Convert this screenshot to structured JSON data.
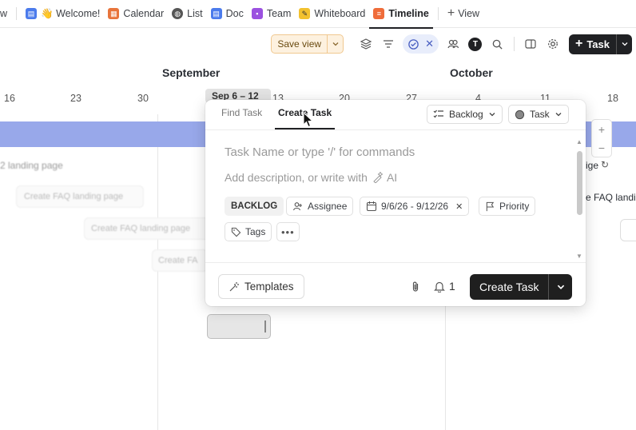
{
  "tabs": [
    {
      "label": "w",
      "icon": "",
      "color": ""
    },
    {
      "label": "👋 Welcome!",
      "icon": "doc-icon",
      "color": "#4b7bec"
    },
    {
      "label": "Calendar",
      "icon": "calendar-icon",
      "color": "#e8743b"
    },
    {
      "label": "List",
      "icon": "globe-icon",
      "color": "#555"
    },
    {
      "label": "Doc",
      "icon": "doc-icon",
      "color": "#4b7bec"
    },
    {
      "label": "Team",
      "icon": "team-icon",
      "color": "#9b51e0"
    },
    {
      "label": "Whiteboard",
      "icon": "whiteboard-icon",
      "color": "#f2c12e"
    },
    {
      "label": "Timeline",
      "icon": "timeline-icon",
      "color": "#ef6c3a",
      "active": true
    }
  ],
  "add_view_label": "View",
  "toolbar": {
    "save_view_label": "Save view",
    "avatar_initial": "T",
    "task_button_label": "Task"
  },
  "timeline": {
    "months": [
      "September",
      "October"
    ],
    "days": [
      "16",
      "23",
      "30",
      "13",
      "20",
      "27",
      "4",
      "11",
      "18"
    ],
    "current_week_label": "Sep 6 – 12",
    "ghost_items": [
      "2 landing page",
      "Create FAQ landing page",
      "Create FAQ landing page",
      "Create FA"
    ],
    "right_items": [
      "ige",
      "e FAQ landi"
    ],
    "band_color": "#98a8ea"
  },
  "popup": {
    "tabs": {
      "find": "Find Task",
      "create": "Create Task"
    },
    "list_select": "Backlog",
    "type_select": "Task",
    "name_placeholder": "Task Name or type '/' for commands",
    "desc_placeholder": "Add description, or write with",
    "ai_label": "AI",
    "status": "BACKLOG",
    "assignee": "Assignee",
    "dates": "9/6/26 - 9/12/26",
    "priority": "Priority",
    "tags": "Tags",
    "templates_label": "Templates",
    "notify_count": "1",
    "create_label": "Create Task"
  }
}
